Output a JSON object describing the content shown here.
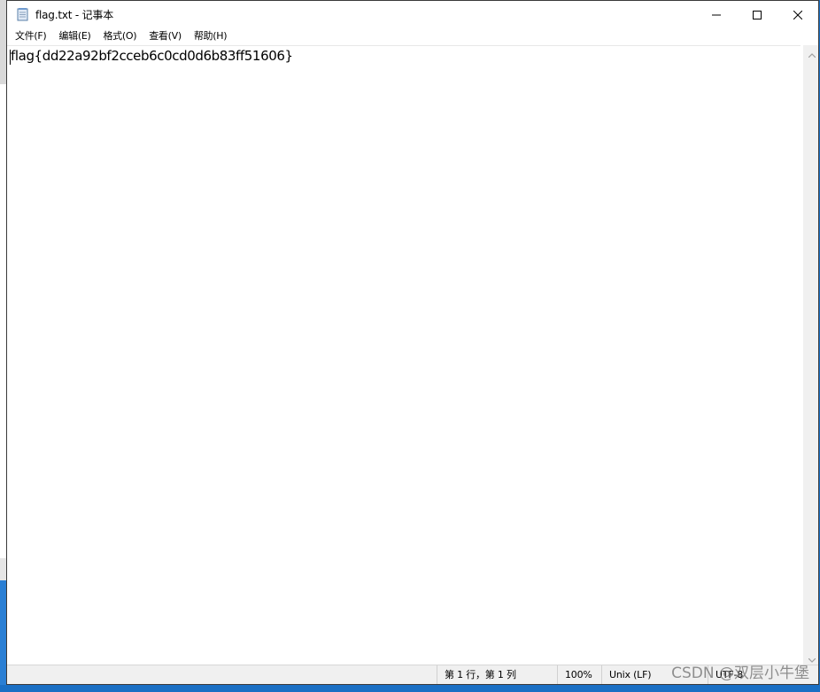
{
  "window": {
    "title": "flag.txt - 记事本",
    "icon": "notepad-icon",
    "controls": [
      "minimize-icon",
      "maximize-icon",
      "close-icon"
    ]
  },
  "menu": {
    "file": "文件(F)",
    "edit": "编辑(E)",
    "format": "格式(O)",
    "view": "查看(V)",
    "help": "帮助(H)"
  },
  "editor": {
    "content": "flag{dd22a92bf2cceb6c0cd0d6b83ff51606}"
  },
  "status": {
    "position": "第 1 行，第 1 列",
    "zoom": "100%",
    "line_ending": "Unix (LF)",
    "encoding": "UTF-8"
  },
  "watermark": "CSDN @双层小牛堡",
  "colors": {
    "desktop": "#1a6fc4",
    "window_border": "#3a3a3a",
    "statusbar": "#f0f0f0"
  }
}
